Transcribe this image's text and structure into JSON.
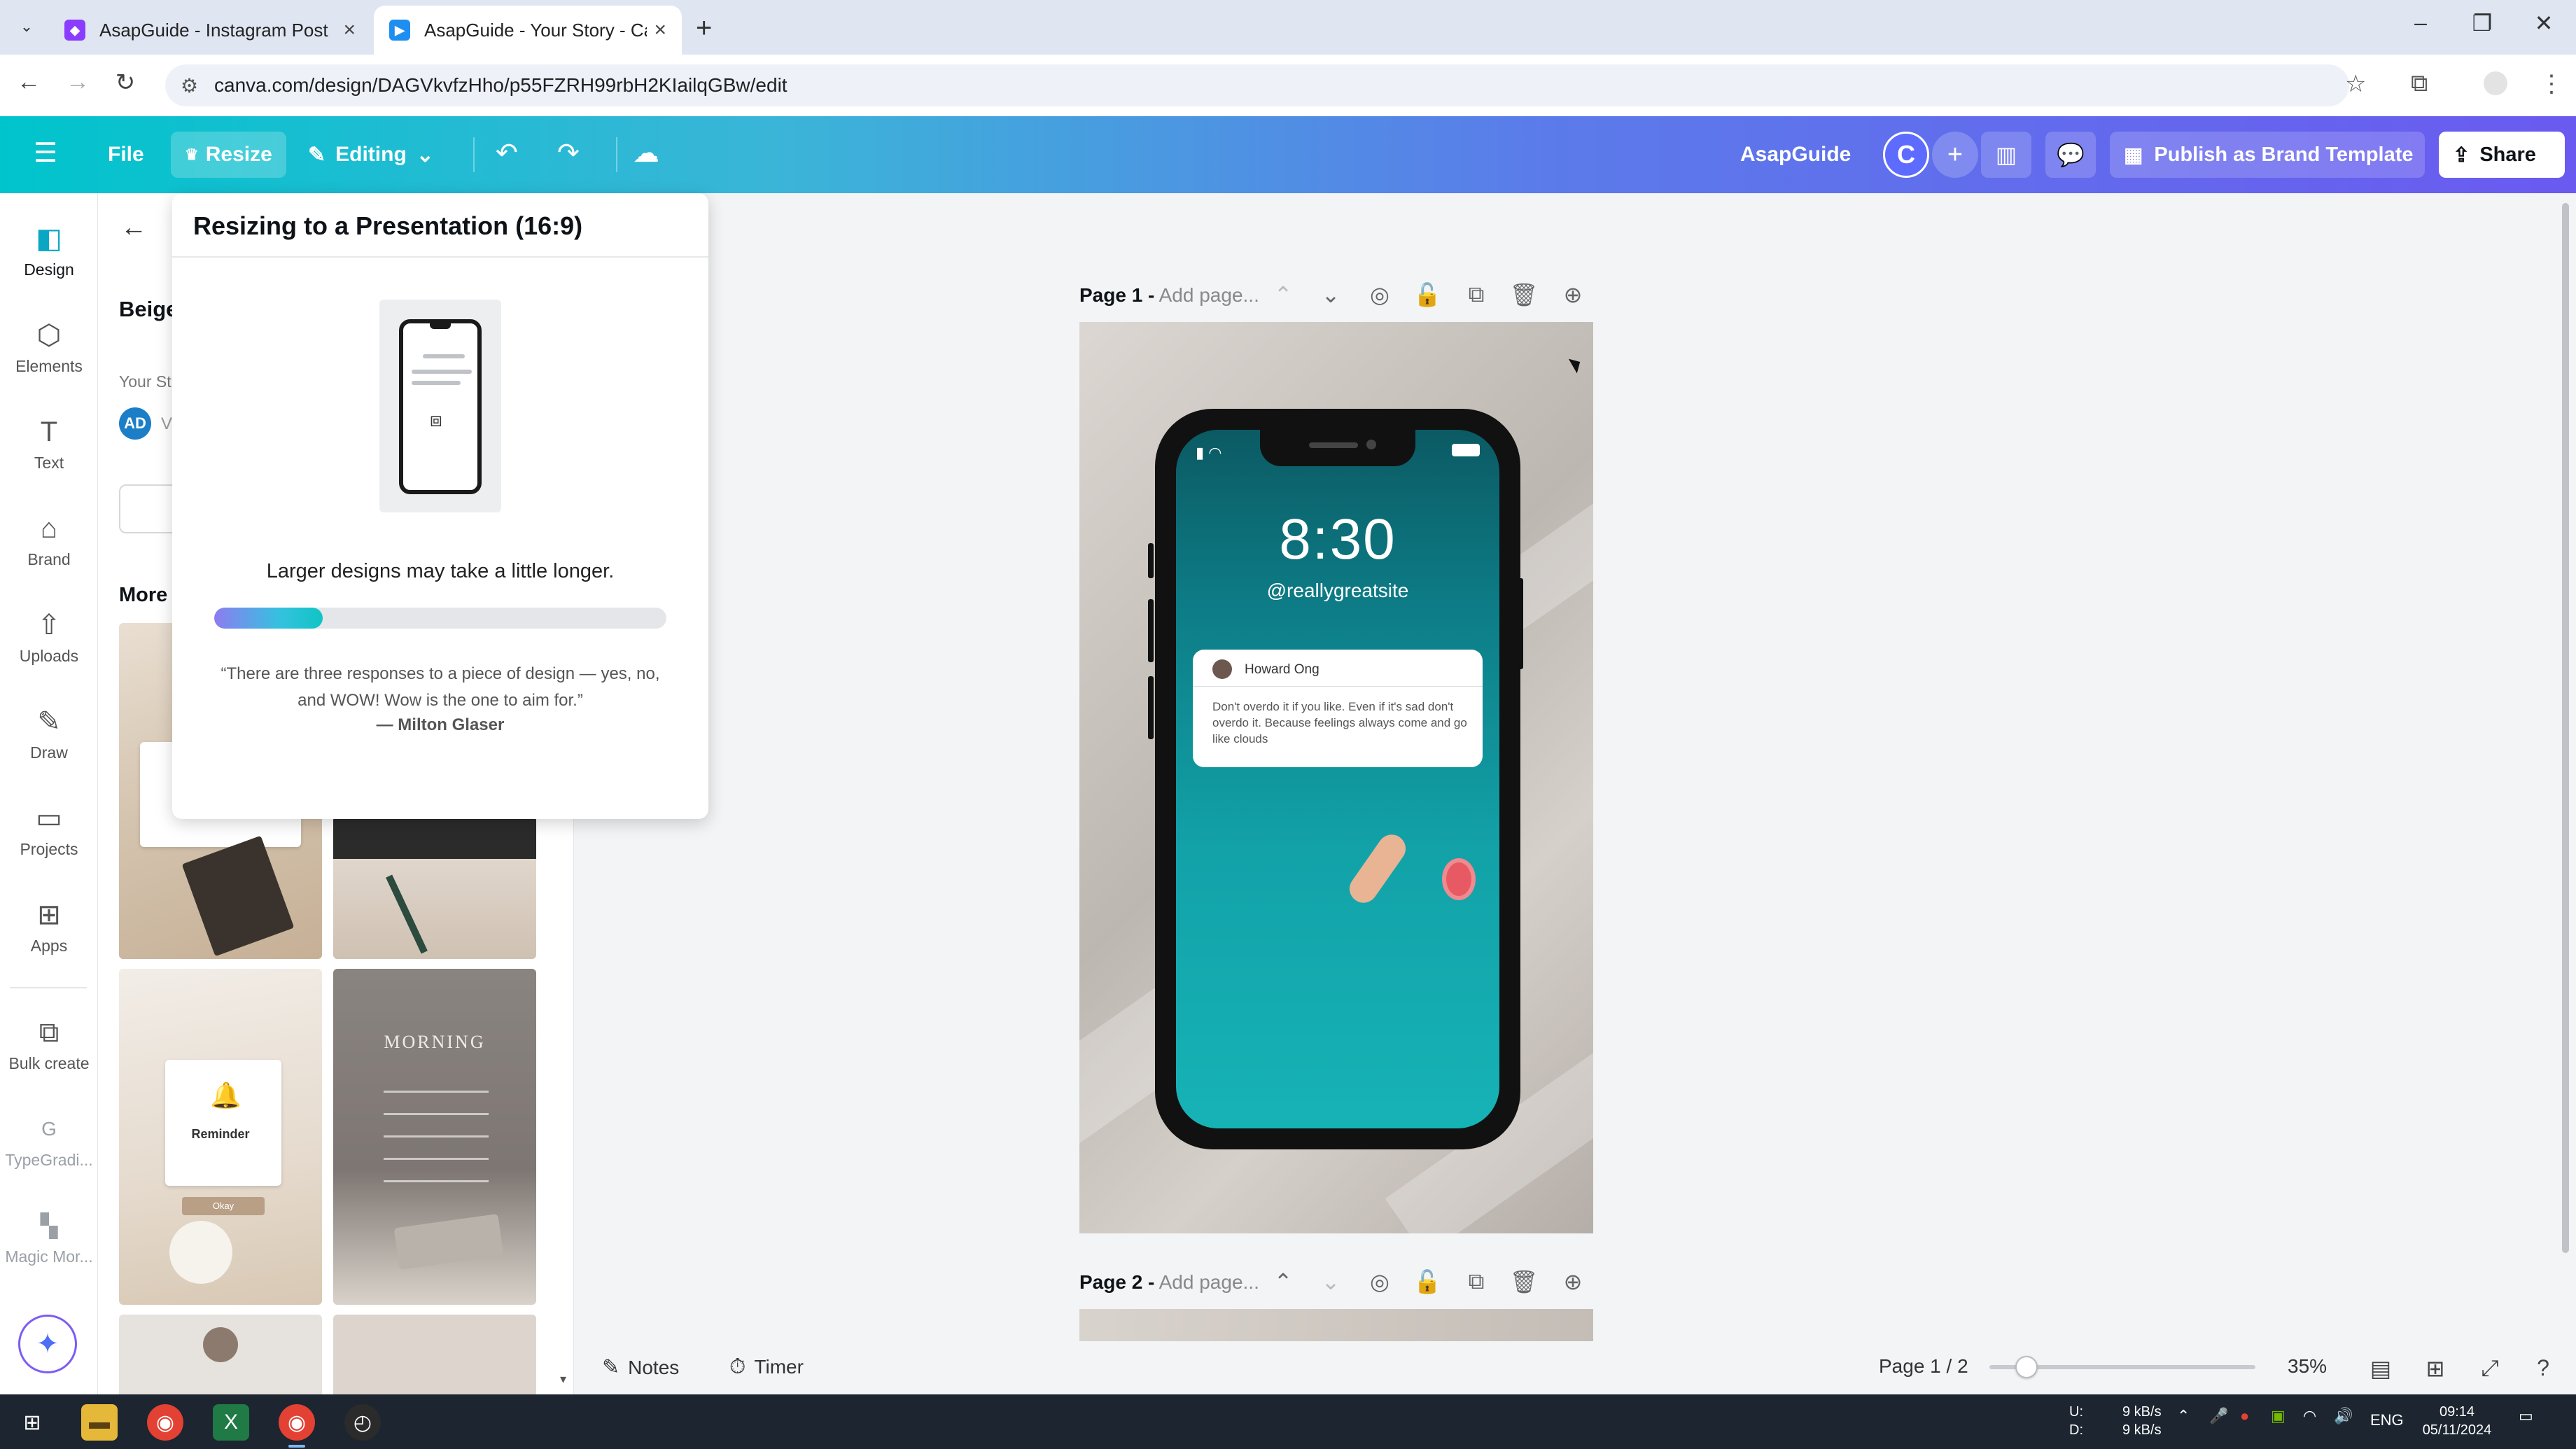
{
  "browser": {
    "tabs": [
      {
        "title": "AsapGuide - Instagram Post",
        "active": false
      },
      {
        "title": "AsapGuide - Your Story - Canva",
        "active": true
      }
    ],
    "url": "canva.com/design/DAGVkvfzHho/p55FZRH99rbH2KIailqGBw/edit"
  },
  "header": {
    "file": "File",
    "resize": "Resize",
    "editing": "Editing",
    "team": "AsapGuide",
    "avatar_letter": "C",
    "plus": "+",
    "publish": "Publish as Brand Template",
    "share": "Share"
  },
  "rail": [
    {
      "label": "Design",
      "icon": "design-icon"
    },
    {
      "label": "Elements",
      "icon": "elements-icon"
    },
    {
      "label": "Text",
      "icon": "text-icon"
    },
    {
      "label": "Brand",
      "icon": "brand-icon"
    },
    {
      "label": "Uploads",
      "icon": "uploads-icon"
    },
    {
      "label": "Draw",
      "icon": "draw-icon"
    },
    {
      "label": "Projects",
      "icon": "projects-icon"
    },
    {
      "label": "Apps",
      "icon": "apps-icon"
    },
    {
      "label": "Bulk create",
      "icon": "bulk-create-icon"
    },
    {
      "label": "TypeGradi...",
      "icon": "typegradient-icon"
    },
    {
      "label": "Magic Mor...",
      "icon": "magic-morph-icon"
    }
  ],
  "panel": {
    "title": "Beige Remi",
    "subtitle": "Your St",
    "author_initials": "AD",
    "author_letter": "V",
    "more_title": "More",
    "thumb_reminder": "Reminder",
    "thumb_okay": "Okay",
    "thumb_morning": "MORNING"
  },
  "popover": {
    "title": "Resizing to a Presentation (16:9)",
    "message": "Larger designs may take a little longer.",
    "progress": 0.24,
    "quote": "“There are three responses to a piece of design — yes, no, and WOW! Wow is the one to aim for.”",
    "author": "— Milton Glaser"
  },
  "canvas": {
    "page1_label": "Page 1 -",
    "page1_add": "Add page...",
    "page2_label": "Page 2 -",
    "page2_add": "Add page...",
    "phone": {
      "time": "8:30",
      "handle": "@reallygreatsite",
      "notif_name": "Howard Ong",
      "notif_msg": "Don't overdo it if you like. Even if it's sad don't overdo it. Because feelings always come and go like clouds"
    }
  },
  "bottombar": {
    "notes": "Notes",
    "timer": "Timer",
    "page_count": "Page 1 / 2",
    "zoom": "35%",
    "zoom_fraction": 0.14
  },
  "taskbar": {
    "net_up_label": "U:",
    "net_down_label": "D:",
    "net_up": "9 kB/s",
    "net_down": "9 kB/s",
    "lang": "ENG",
    "time": "09:14",
    "date": "05/11/2024"
  }
}
